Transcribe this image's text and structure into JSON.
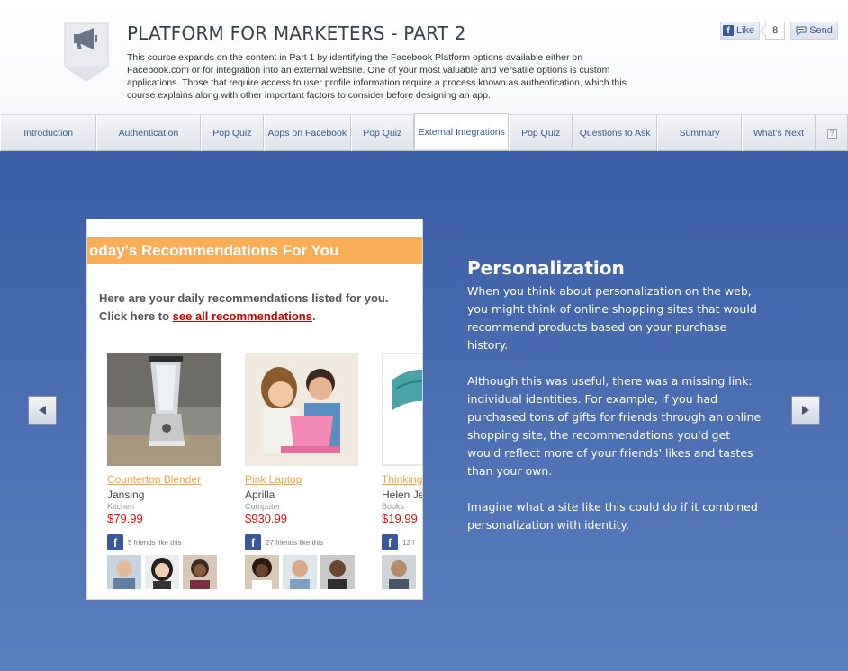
{
  "header": {
    "title": "PLATFORM FOR MARKETERS - PART 2",
    "description": "This course expands on the content in Part 1 by identifying the Facebook Platform options available either on Facebook.com or for integration into an external website. One of your most valuable and versatile options is custom applications. Those that require access to user profile information require a process known as authentication, which this course explains along with other important factors to consider before designing an app.",
    "badge_icon": "megaphone-icon",
    "like_label": "Like",
    "like_count": "8",
    "send_label": "Send"
  },
  "nav": {
    "tabs": [
      {
        "label": "Introduction"
      },
      {
        "label": "Authentication"
      },
      {
        "label": "Pop Quiz"
      },
      {
        "label": "Apps on Facebook"
      },
      {
        "label": "Pop Quiz"
      },
      {
        "label": "External Integrations"
      },
      {
        "label": "Pop Quiz"
      },
      {
        "label": "Questions to Ask"
      },
      {
        "label": "Summary"
      },
      {
        "label": "What's Next"
      }
    ],
    "active_tab": "External Integrations",
    "help_label": "?"
  },
  "card": {
    "banner": "oday's Recommendations For You",
    "intro_line1": "Here are your daily recommendations listed for you.",
    "intro_line2_prefix": "Click here to ",
    "intro_link": "see all recommendations",
    "intro_suffix": ".",
    "products": [
      {
        "name": "Countertop Blender",
        "brand": "Jansing",
        "category": "Kitchen",
        "price": "$79.99",
        "friends": "5 friends like this"
      },
      {
        "name": "Pink Laptop",
        "brand": "Aprilla",
        "category": "Computer",
        "price": "$930.99",
        "friends": "27 friends like this"
      },
      {
        "name": "Thinking",
        "brand": "Helen Je",
        "category": "Books",
        "price": "$19.99",
        "friends": "12 f"
      }
    ]
  },
  "panel": {
    "heading": "Personalization",
    "paragraphs": [
      "When you think about personalization on the web, you might think of online shopping sites that would recommend products based on your purchase history.",
      "Although this was useful, there was a missing link: individual identities. For example, if you had purchased tons of gifts for friends through an online shopping site, the recommendations you'd get would reflect more of your friends' likes and tastes than your own.",
      "Imagine what a site like this could do if it combined personalization with identity."
    ]
  },
  "colors": {
    "stage_blue": "#3b5ea4",
    "banner_orange": "#f9ae57",
    "price_red": "#dd1111",
    "link_blue": "#3b5a91"
  }
}
